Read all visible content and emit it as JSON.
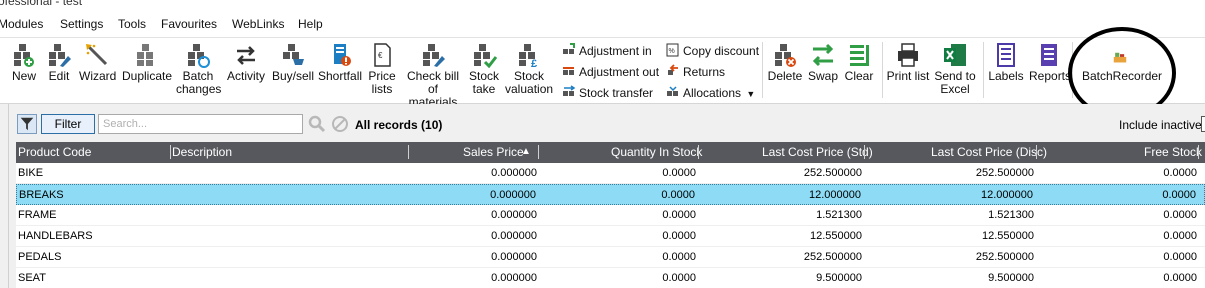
{
  "window": {
    "title_fragment": "ofessional - test"
  },
  "menu": [
    "Modules",
    "Settings",
    "Tools",
    "Favourites",
    "WebLinks",
    "Help"
  ],
  "ribbon": {
    "buttons": [
      {
        "label": "New",
        "icon": "new-stock-icon"
      },
      {
        "label": "Edit",
        "icon": "edit-stock-icon"
      },
      {
        "label": "Wizard",
        "icon": "wizard-wand-icon"
      },
      {
        "label": "Duplicate",
        "icon": "duplicate-icon"
      },
      {
        "label1": "Batch",
        "label2": "changes",
        "icon": "batch-changes-icon"
      },
      {
        "label": "Activity",
        "icon": "activity-arrows-icon"
      },
      {
        "label": "Buy/sell",
        "icon": "buy-sell-icon"
      },
      {
        "label": "Shortfall",
        "icon": "shortfall-icon"
      },
      {
        "label1": "Price",
        "label2": "lists",
        "icon": "price-list-icon"
      },
      {
        "label1": "Check bill",
        "label2": "of materials",
        "icon": "bill-of-materials-icon"
      },
      {
        "label1": "Stock",
        "label2": "take",
        "icon": "stock-take-icon"
      },
      {
        "label1": "Stock",
        "label2": "valuation",
        "icon": "stock-valuation-icon"
      }
    ],
    "small": {
      "adjustment_in": "Adjustment in",
      "adjustment_out": "Adjustment out",
      "stock_transfer": "Stock transfer",
      "copy_discount": "Copy discount",
      "returns": "Returns",
      "allocations": "Allocations"
    },
    "actions": {
      "delete": "Delete",
      "swap": "Swap",
      "clear": "Clear",
      "print_list": "Print list",
      "send1": "Send to",
      "send2": "Excel",
      "labels": "Labels",
      "reports": "Reports",
      "batch_recorder": "BatchRecorder"
    }
  },
  "filter": {
    "button": "Filter",
    "search_placeholder": "Search...",
    "records": "All records (10)",
    "include_inactive": "Include inactive"
  },
  "grid": {
    "columns": [
      "Product Code",
      "Description",
      "Sales Price",
      "Quantity In Stock",
      "Last Cost Price (Std)",
      "Last Cost Price (Disc)",
      "Free Stock"
    ],
    "sort_indicator": "▲",
    "rows": [
      {
        "code": "BIKE",
        "desc": "",
        "sales": "0.000000",
        "qty": "0.0000",
        "std": "252.500000",
        "disc": "252.500000",
        "free": "0.0000"
      },
      {
        "code": "BREAKS",
        "desc": "",
        "sales": "0.000000",
        "qty": "0.0000",
        "std": "12.000000",
        "disc": "12.000000",
        "free": "0.0000"
      },
      {
        "code": "FRAME",
        "desc": "",
        "sales": "0.000000",
        "qty": "0.0000",
        "std": "1.521300",
        "disc": "1.521300",
        "free": "0.0000"
      },
      {
        "code": "HANDLEBARS",
        "desc": "",
        "sales": "0.000000",
        "qty": "0.0000",
        "std": "12.550000",
        "disc": "12.550000",
        "free": "0.0000"
      },
      {
        "code": "PEDALS",
        "desc": "",
        "sales": "0.000000",
        "qty": "0.0000",
        "std": "252.500000",
        "disc": "252.500000",
        "free": "0.0000"
      },
      {
        "code": "SEAT",
        "desc": "",
        "sales": "0.000000",
        "qty": "0.0000",
        "std": "9.500000",
        "disc": "9.500000",
        "free": "0.0000"
      }
    ],
    "selected_row": 1,
    "colors": {
      "header_bg": "#56585d",
      "selected_bg": "#8ddbf4"
    }
  }
}
